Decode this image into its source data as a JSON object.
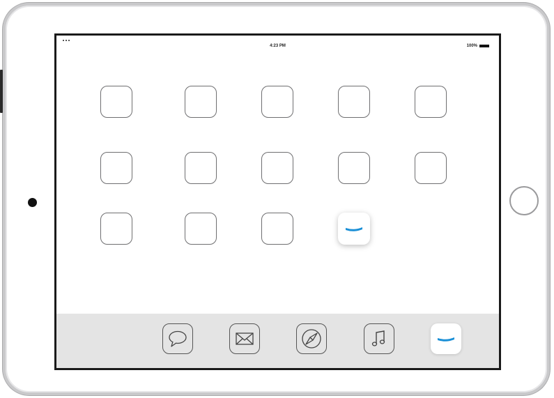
{
  "status_bar": {
    "time": "4:23 PM",
    "battery_percent": "100%",
    "battery_level": 1.0
  },
  "home_screen": {
    "app_slots": [
      {
        "id": "r1c1",
        "kind": "blank"
      },
      {
        "id": "r1c2",
        "kind": "blank"
      },
      {
        "id": "r1c3",
        "kind": "blank"
      },
      {
        "id": "r1c4",
        "kind": "blank"
      },
      {
        "id": "r1c5",
        "kind": "blank"
      },
      {
        "id": "r2c1",
        "kind": "blank"
      },
      {
        "id": "r2c2",
        "kind": "blank"
      },
      {
        "id": "r2c3",
        "kind": "blank"
      },
      {
        "id": "r2c4",
        "kind": "blank"
      },
      {
        "id": "r2c5",
        "kind": "blank"
      },
      {
        "id": "r3c1",
        "kind": "blank"
      },
      {
        "id": "r3c2",
        "kind": "blank"
      },
      {
        "id": "r3c3",
        "kind": "blank"
      },
      {
        "id": "r3c4",
        "kind": "wave-app"
      }
    ]
  },
  "dock": {
    "items": [
      {
        "icon": "messages-icon"
      },
      {
        "icon": "mail-icon"
      },
      {
        "icon": "safari-compass-icon"
      },
      {
        "icon": "music-note-icon"
      },
      {
        "icon": "wave-app-icon"
      }
    ]
  },
  "colors": {
    "accent_wave": "#1a8fd6",
    "dock_background": "#e4e4e4",
    "screen_border": "#1a1a1a",
    "frame": "#c9c9cb"
  }
}
